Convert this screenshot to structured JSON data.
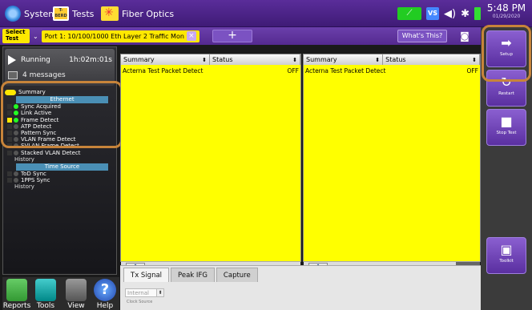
{
  "topbar": {
    "system_label": "System",
    "tests_icon_text": "T-BERD",
    "tests_label": "Tests",
    "fiber_label": "Fiber Optics",
    "vs_label": "VS",
    "time": "5:48 PM",
    "date": "01/29/2020"
  },
  "secbar": {
    "select_test_label": "Select Test",
    "port_label": "Port 1: 10/100/1000 Eth Layer 2 Traffic Mon",
    "add_label": "+",
    "whats_this_label": "What's This?"
  },
  "status": {
    "running_label": "Running",
    "elapsed": "1h:02m:01s",
    "messages_label": "4 messages"
  },
  "tree": {
    "summary_label": "Summary",
    "ethernet_header": "Ethernet",
    "items_ethernet": [
      {
        "label": "Sync Acquired",
        "state": "green",
        "mark": "none"
      },
      {
        "label": "Link Active",
        "state": "green",
        "mark": "none"
      },
      {
        "label": "Frame Detect",
        "state": "green",
        "mark": "yellow"
      },
      {
        "label": "ATP Detect",
        "state": "off",
        "mark": "none"
      },
      {
        "label": "Pattern Sync",
        "state": "off",
        "mark": "none"
      },
      {
        "label": "VLAN Frame Detect",
        "state": "off",
        "mark": "none"
      },
      {
        "label": "SVLAN Frame Detect",
        "state": "off",
        "mark": "none"
      },
      {
        "label": "Stacked VLAN Detect",
        "state": "off",
        "mark": "none"
      }
    ],
    "history_label_1": "History",
    "time_source_header": "Time Source",
    "items_time": [
      {
        "label": "ToD Sync",
        "state": "off",
        "mark": "none"
      },
      {
        "label": "1PPS Sync",
        "state": "off",
        "mark": "none"
      }
    ],
    "history_label_2": "History"
  },
  "bottom_left": {
    "reports_label": "Reports",
    "tools_label": "Tools",
    "view_label": "View",
    "help_label": "Help",
    "help_glyph": "?"
  },
  "panes": [
    {
      "category": "Summary",
      "group": "Status",
      "row_label": "Acterna Test Packet Detect",
      "row_value": "OFF",
      "scroll_glyph": "✥"
    },
    {
      "category": "Summary",
      "group": "Status",
      "row_label": "Acterna Test Packet Detect",
      "row_value": "OFF",
      "scroll_glyph": "✥"
    }
  ],
  "bottom": {
    "tabs": [
      "Tx Signal",
      "Peak IFG",
      "Capture"
    ],
    "clock_select_value": "Internal",
    "clock_source_label": "Clock Source"
  },
  "right": {
    "setup_label": "Setup",
    "restart_label": "Restart",
    "stop_label": "Stop Test",
    "toolkit_label": "Toolkit"
  },
  "colors": {
    "highlight": "#c7843a",
    "pane_bg": "#ffff00",
    "accent_purple": "#5a2d9a",
    "led_green": "#22ff22"
  }
}
